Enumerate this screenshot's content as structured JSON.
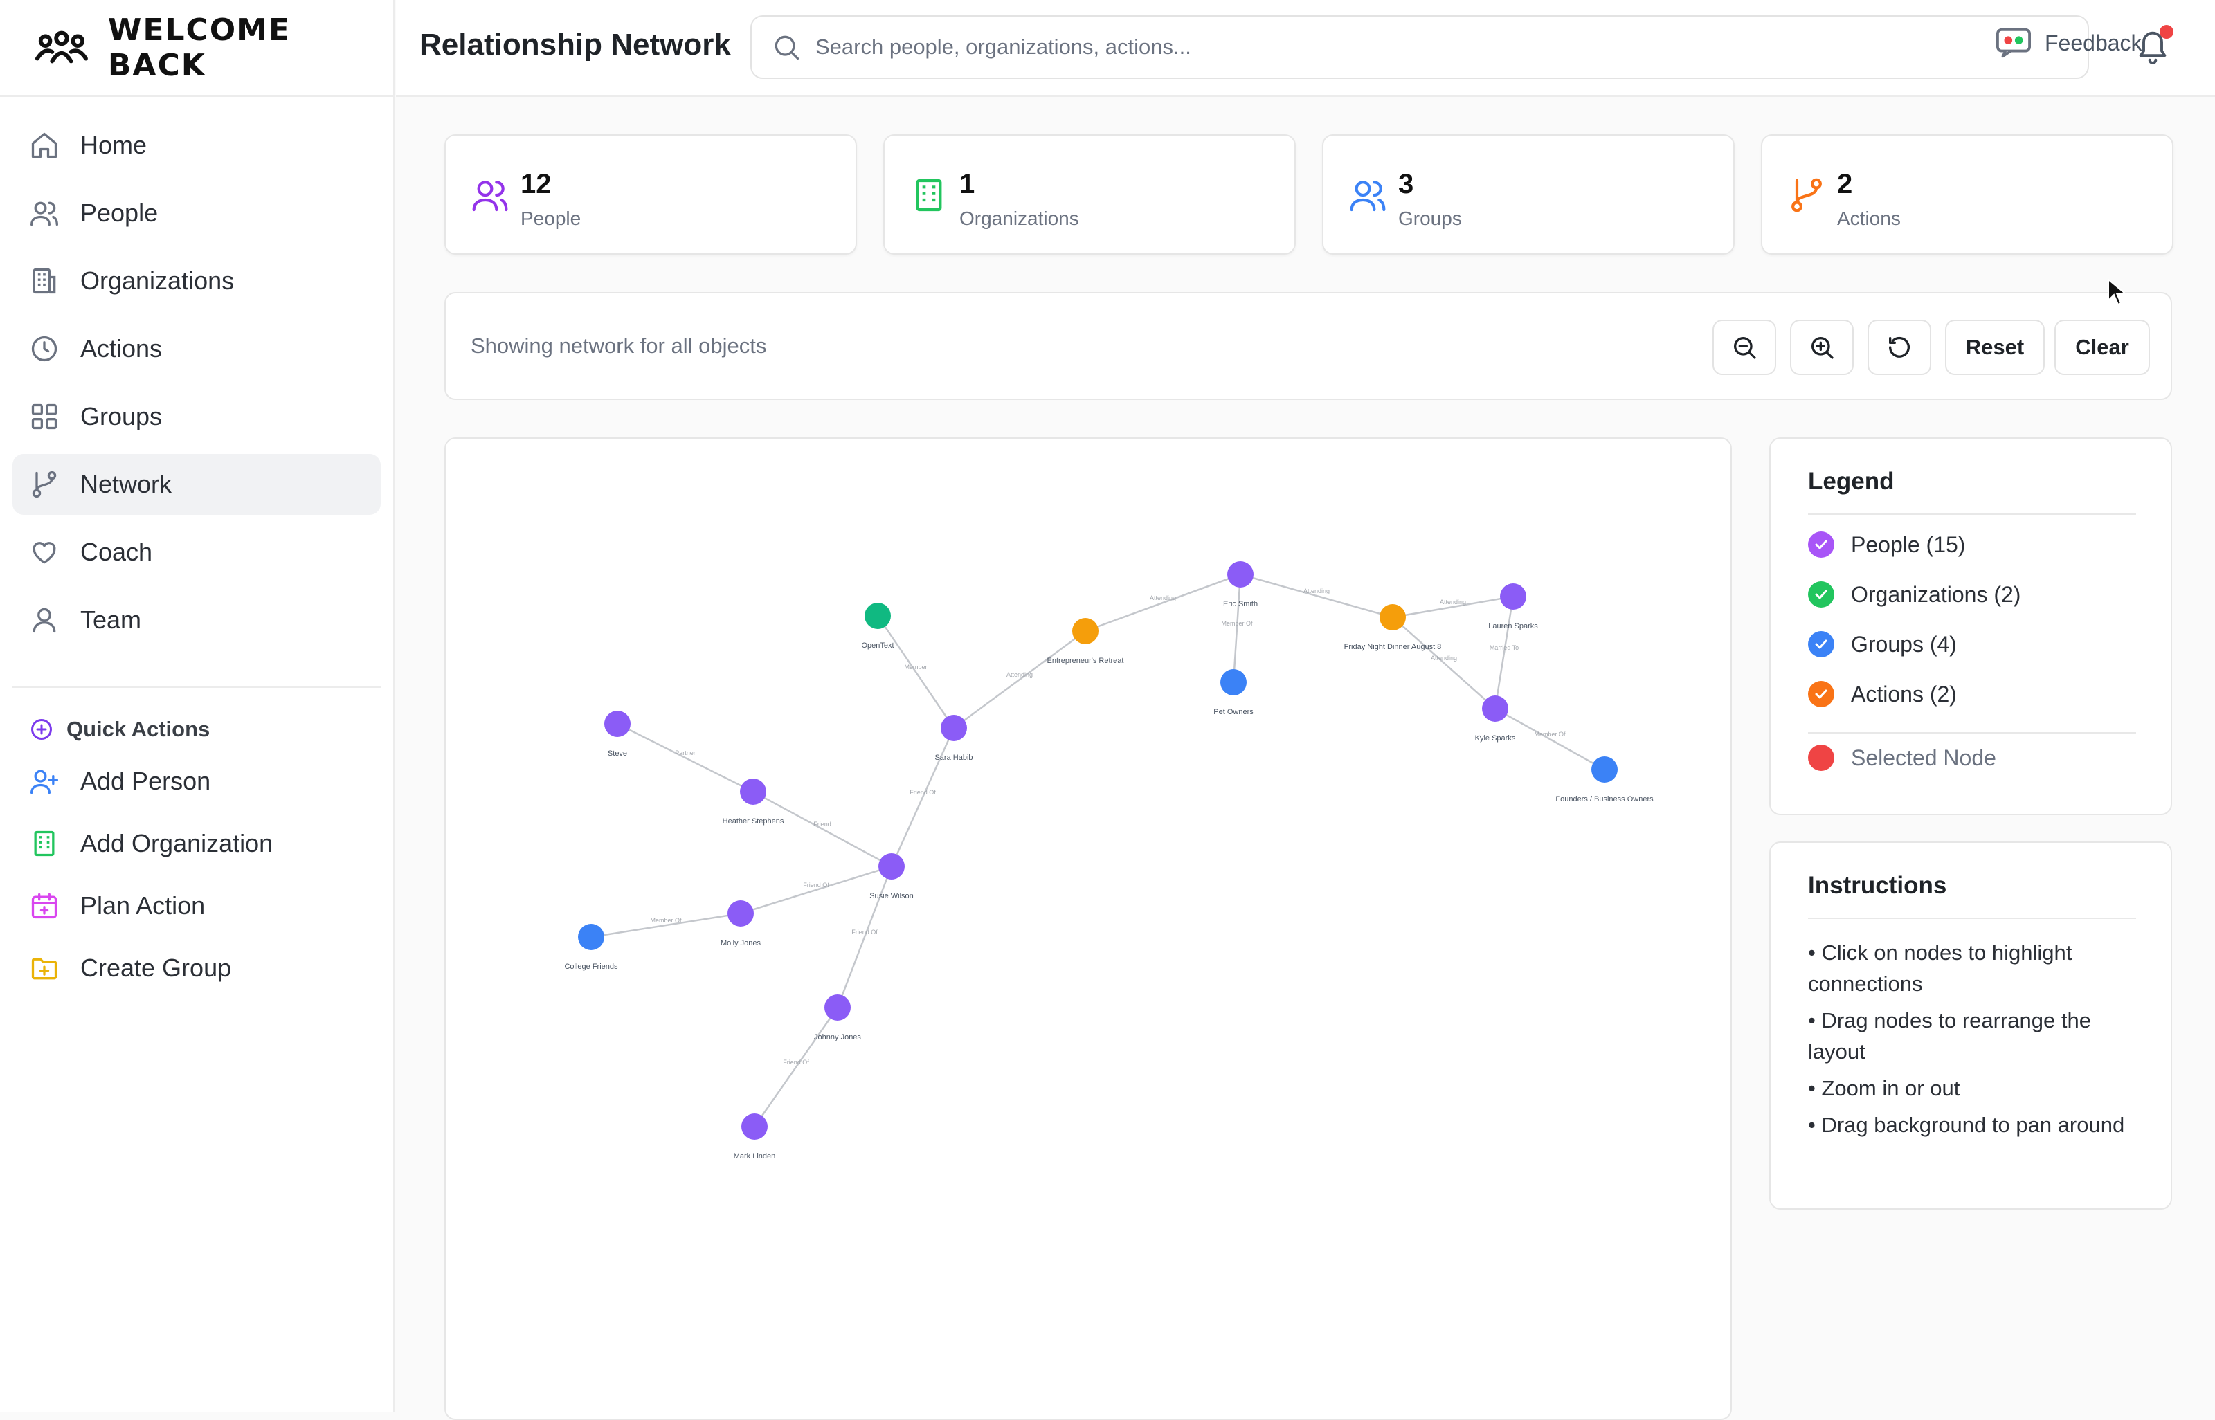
{
  "brand": {
    "name": "WELCOME BACK"
  },
  "sidebar": {
    "items": [
      {
        "label": "Home",
        "icon": "home-icon"
      },
      {
        "label": "People",
        "icon": "users-icon"
      },
      {
        "label": "Organizations",
        "icon": "building-icon"
      },
      {
        "label": "Actions",
        "icon": "clock-icon"
      },
      {
        "label": "Groups",
        "icon": "grid-icon"
      },
      {
        "label": "Network",
        "icon": "git-branch-icon",
        "active": true
      },
      {
        "label": "Coach",
        "icon": "heart-icon"
      },
      {
        "label": "Team",
        "icon": "user-icon"
      }
    ],
    "quick_actions": {
      "title": "Quick Actions",
      "items": [
        {
          "label": "Add Person",
          "icon": "user-plus-icon"
        },
        {
          "label": "Add Organization",
          "icon": "building-icon"
        },
        {
          "label": "Plan Action",
          "icon": "calendar-plus-icon"
        },
        {
          "label": "Create Group",
          "icon": "folder-plus-icon"
        }
      ]
    }
  },
  "header": {
    "title": "Relationship Network",
    "search_placeholder": "Search people, organizations, actions...",
    "feedback_label": "Feedback"
  },
  "stats": [
    {
      "value": "12",
      "label": "People",
      "color": "#9333ea"
    },
    {
      "value": "1",
      "label": "Organizations",
      "color": "#22c55e"
    },
    {
      "value": "3",
      "label": "Groups",
      "color": "#3b82f6"
    },
    {
      "value": "2",
      "label": "Actions",
      "color": "#f97316"
    }
  ],
  "toolbar": {
    "status": "Showing network for all objects",
    "reset_label": "Reset",
    "clear_label": "Clear"
  },
  "legend": {
    "title": "Legend",
    "items": [
      {
        "label": "People (15)",
        "color": "#a855f7"
      },
      {
        "label": "Organizations (2)",
        "color": "#22c55e"
      },
      {
        "label": "Groups (4)",
        "color": "#3b82f6"
      },
      {
        "label": "Actions (2)",
        "color": "#f97316"
      }
    ],
    "selected": {
      "label": "Selected Node",
      "color": "#ef4444"
    }
  },
  "instructions": {
    "title": "Instructions",
    "items": [
      "• Click on nodes to highlight connections",
      "• Drag nodes to rearrange the layout",
      "• Zoom in or out",
      "• Drag background to pan around"
    ]
  },
  "network": {
    "colors": {
      "person": "#8b5cf6",
      "organization": "#10b981",
      "group": "#3b82f6",
      "action": "#f59e0b"
    },
    "nodes": [
      {
        "id": "opentext",
        "label": "OpenText",
        "type": "organization"
      },
      {
        "id": "entre",
        "label": "Entrepreneur's Retreat",
        "type": "action"
      },
      {
        "id": "eric",
        "label": "Eric Smith",
        "type": "person"
      },
      {
        "id": "friday",
        "label": "Friday Night Dinner August 8",
        "type": "action"
      },
      {
        "id": "lauren",
        "label": "Lauren Sparks",
        "type": "person"
      },
      {
        "id": "pet",
        "label": "Pet Owners",
        "type": "group"
      },
      {
        "id": "kyle",
        "label": "Kyle Sparks",
        "type": "person"
      },
      {
        "id": "founders",
        "label": "Founders / Business Owners",
        "type": "group"
      },
      {
        "id": "sara",
        "label": "Sara Habib",
        "type": "person"
      },
      {
        "id": "steve",
        "label": "Steve",
        "type": "person"
      },
      {
        "id": "heather",
        "label": "Heather Stephens",
        "type": "person"
      },
      {
        "id": "susie",
        "label": "Susie Wilson",
        "type": "person"
      },
      {
        "id": "molly",
        "label": "Molly Jones",
        "type": "person"
      },
      {
        "id": "college",
        "label": "College Friends",
        "type": "group"
      },
      {
        "id": "johnny",
        "label": "Johnny Jones",
        "type": "person"
      },
      {
        "id": "mark",
        "label": "Mark Linden",
        "type": "person"
      }
    ],
    "edges": [
      {
        "source": "opentext",
        "target": "sara",
        "label": "Member"
      },
      {
        "source": "entre",
        "target": "eric",
        "label": "Attending"
      },
      {
        "source": "entre",
        "target": "sara",
        "label": "Attending"
      },
      {
        "source": "eric",
        "target": "friday",
        "label": "Attending"
      },
      {
        "source": "eric",
        "target": "pet",
        "label": "Member Of"
      },
      {
        "source": "friday",
        "target": "lauren",
        "label": "Attending"
      },
      {
        "source": "friday",
        "target": "kyle",
        "label": "Attending"
      },
      {
        "source": "lauren",
        "target": "kyle",
        "label": "Married To"
      },
      {
        "source": "kyle",
        "target": "founders",
        "label": "Member Of"
      },
      {
        "source": "sara",
        "target": "susie",
        "label": "Friend Of"
      },
      {
        "source": "steve",
        "target": "heather",
        "label": "Partner"
      },
      {
        "source": "heather",
        "target": "susie",
        "label": "Friend"
      },
      {
        "source": "susie",
        "target": "molly",
        "label": "Friend Of"
      },
      {
        "source": "molly",
        "target": "college",
        "label": "Member Of"
      },
      {
        "source": "susie",
        "target": "johnny",
        "label": "Friend Of"
      },
      {
        "source": "johnny",
        "target": "mark",
        "label": "Friend Of"
      }
    ]
  }
}
